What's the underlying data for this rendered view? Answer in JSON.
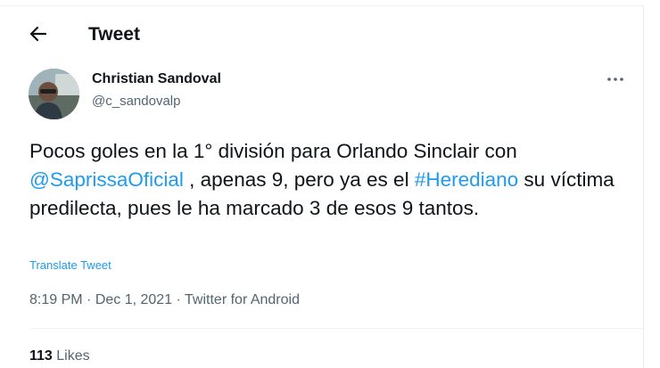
{
  "header": {
    "title": "Tweet",
    "back_icon": "arrow-left-icon"
  },
  "author": {
    "name": "Christian Sandoval",
    "handle": "@c_sandovalp"
  },
  "tweet": {
    "text_1": "Pocos goles en la 1° división para Orlando Sinclair con ",
    "mention": "@SaprissaOficial",
    "text_2": " , apenas 9, pero ya es el ",
    "hashtag": "#Herediano",
    "text_3": " su víctima predilecta, pues le ha marcado 3 de esos 9 tantos.",
    "translate_label": "Translate Tweet"
  },
  "meta": {
    "time": "8:19 PM",
    "sep1": " · ",
    "date": "Dec 1, 2021",
    "sep2": " · ",
    "source": "Twitter for Android"
  },
  "stats": {
    "likes_count": "113",
    "likes_label": " Likes"
  },
  "colors": {
    "accent": "#1d9bf0",
    "text": "#0f1419",
    "muted": "#536471"
  }
}
